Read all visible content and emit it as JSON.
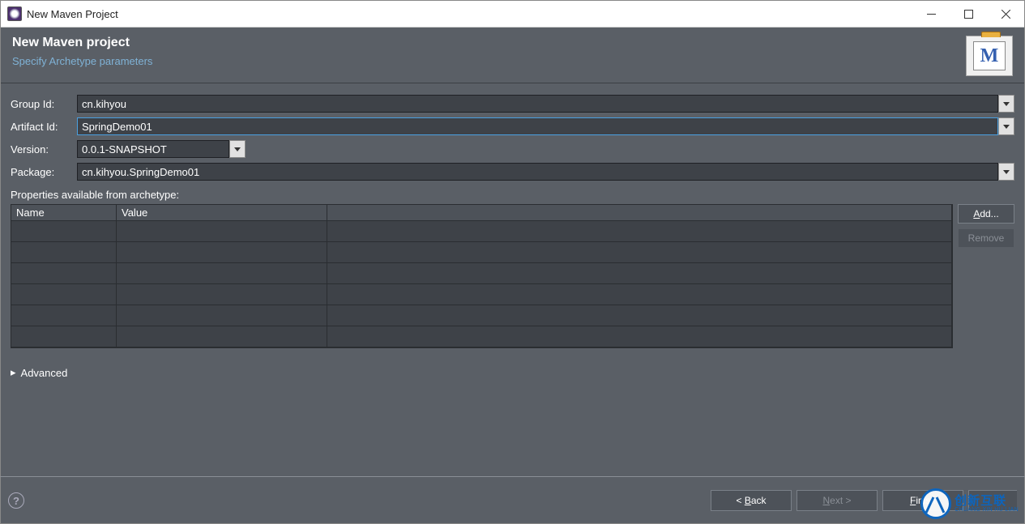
{
  "window": {
    "title": "New Maven Project"
  },
  "header": {
    "title": "New Maven project",
    "subtitle": "Specify Archetype parameters"
  },
  "form": {
    "groupId": {
      "label": "Group Id:",
      "value": "cn.kihyou"
    },
    "artifactId": {
      "label": "Artifact Id:",
      "value": "SpringDemo01"
    },
    "version": {
      "label": "Version:",
      "value": "0.0.1-SNAPSHOT"
    },
    "package": {
      "label": "Package:",
      "value": "cn.kihyou.SpringDemo01"
    }
  },
  "properties": {
    "heading": "Properties available from archetype:",
    "columns": {
      "name": "Name",
      "value": "Value"
    },
    "rows": [
      {},
      {},
      {},
      {},
      {},
      {}
    ],
    "buttons": {
      "add": "Add...",
      "remove": "Remove"
    }
  },
  "advanced": {
    "label": "Advanced"
  },
  "footer": {
    "back": "< Back",
    "next": "Next >",
    "finish": "Finish"
  },
  "watermark": {
    "cn": "创新互联",
    "en": "CHUANG XIN HU LIAN"
  }
}
